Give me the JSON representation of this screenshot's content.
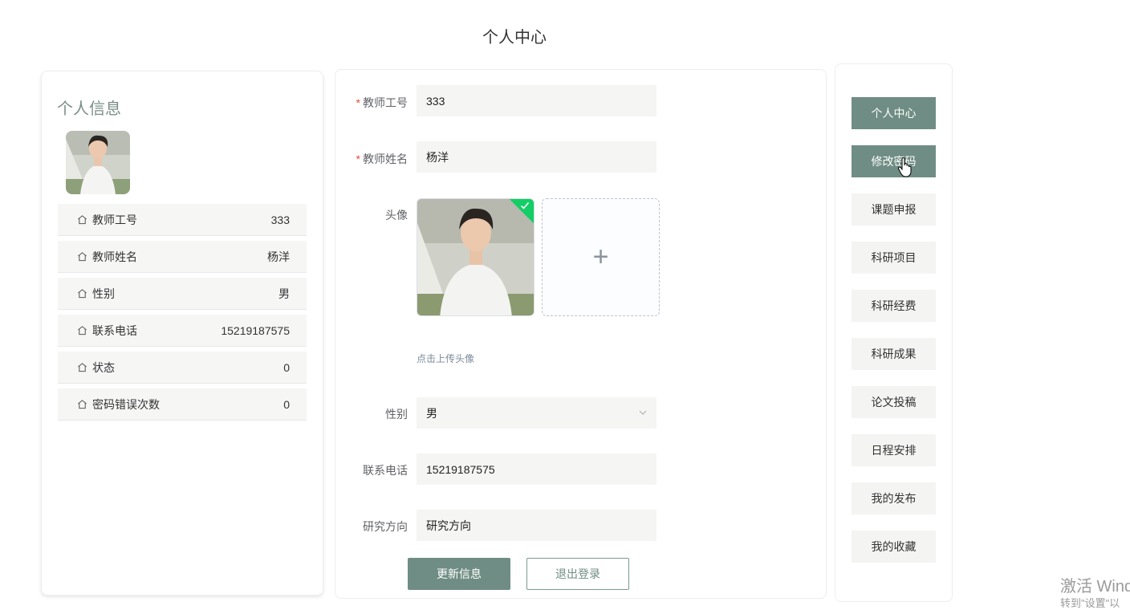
{
  "page": {
    "title": "个人中心"
  },
  "info": {
    "title": "个人信息",
    "rows": [
      {
        "label": "教师工号",
        "value": "333"
      },
      {
        "label": "教师姓名",
        "value": "杨洋"
      },
      {
        "label": "性别",
        "value": "男"
      },
      {
        "label": "联系电话",
        "value": "15219187575"
      },
      {
        "label": "状态",
        "value": "0"
      },
      {
        "label": "密码错误次数",
        "value": "0"
      }
    ]
  },
  "form": {
    "teacher_no": {
      "label": "教师工号",
      "value": "333"
    },
    "teacher_name": {
      "label": "教师姓名",
      "value": "杨洋"
    },
    "avatar": {
      "label": "头像",
      "upload_tip": "点击上传头像",
      "add_icon": "+"
    },
    "gender": {
      "label": "性别",
      "value": "男"
    },
    "phone": {
      "label": "联系电话",
      "value": "15219187575"
    },
    "research": {
      "label": "研究方向",
      "value": "研究方向"
    },
    "required_mark": "*",
    "update_label": "更新信息",
    "logout_label": "退出登录"
  },
  "menu": {
    "items": [
      {
        "label": "个人中心",
        "active": true
      },
      {
        "label": "修改密码",
        "active": true
      },
      {
        "label": "课题申报",
        "active": false
      },
      {
        "label": "科研项目",
        "active": false
      },
      {
        "label": "科研经费",
        "active": false
      },
      {
        "label": "科研成果",
        "active": false
      },
      {
        "label": "论文投稿",
        "active": false
      },
      {
        "label": "日程安排",
        "active": false
      },
      {
        "label": "我的发布",
        "active": false
      },
      {
        "label": "我的收藏",
        "active": false
      }
    ]
  },
  "watermark": {
    "line1": "激活 Wind",
    "line2": "转到\"设置\"以"
  },
  "colors": {
    "accent": "#6f8d84",
    "success": "#13ce66",
    "required": "#e74c3c"
  },
  "icons": [
    "home-icon",
    "chevron-down-icon",
    "check-icon",
    "plus-icon",
    "hand-cursor-icon"
  ]
}
